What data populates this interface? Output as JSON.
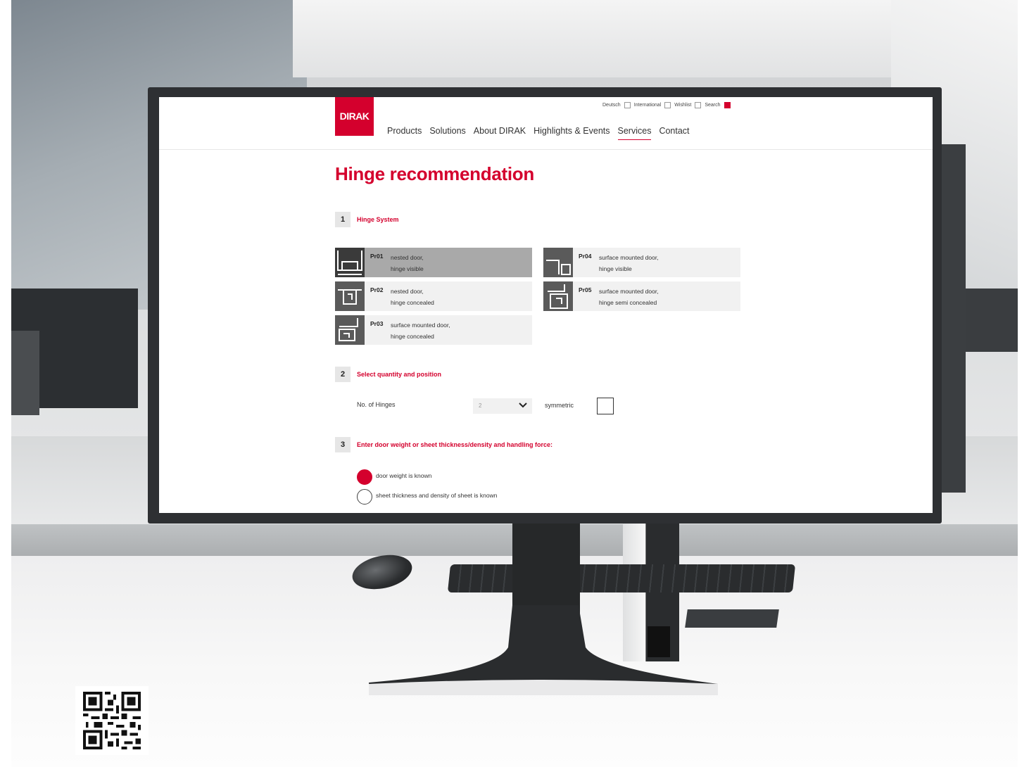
{
  "site": {
    "logo_text": "DIRAK",
    "meta_nav": [
      "Deutsch",
      "International",
      "Wishlist",
      "Search"
    ],
    "main_nav": [
      {
        "label": "Products",
        "active": false
      },
      {
        "label": "Solutions",
        "active": false
      },
      {
        "label": "About DIRAK",
        "active": false
      },
      {
        "label": "Highlights & Events",
        "active": false
      },
      {
        "label": "Services",
        "active": true
      },
      {
        "label": "Contact",
        "active": false
      }
    ],
    "accent_color": "#d4002d"
  },
  "page": {
    "title": "Hinge recommendation",
    "step1": {
      "number": "1",
      "label": "Hinge System",
      "options": [
        {
          "code": "Pr01",
          "desc": "nested door,\nhinge visible",
          "selected": true,
          "icon": "nested-door-visible-icon"
        },
        {
          "code": "Pr02",
          "desc": "nested door,\nhinge concealed",
          "selected": false,
          "icon": "nested-door-concealed-icon"
        },
        {
          "code": "Pr03",
          "desc": "surface mounted door,\nhinge concealed",
          "selected": false,
          "icon": "surface-door-concealed-icon"
        },
        {
          "code": "Pr04",
          "desc": "surface mounted door,\nhinge visible",
          "selected": false,
          "icon": "surface-door-visible-icon"
        },
        {
          "code": "Pr05",
          "desc": "surface mounted door,\nhinge semi concealed",
          "selected": false,
          "icon": "surface-door-semi-icon"
        }
      ]
    },
    "step2": {
      "number": "2",
      "label": "Select quantity and position",
      "hinges_label": "No. of Hinges",
      "hinges_value": "2",
      "symmetric_label": "symmetric"
    },
    "step3": {
      "number": "3",
      "label": "Enter door weight or sheet thickness/density and handling force:",
      "radio_options": [
        {
          "label": "door weight is known",
          "checked": true
        },
        {
          "label": "sheet thickness and density of sheet is known",
          "checked": false
        }
      ]
    }
  }
}
